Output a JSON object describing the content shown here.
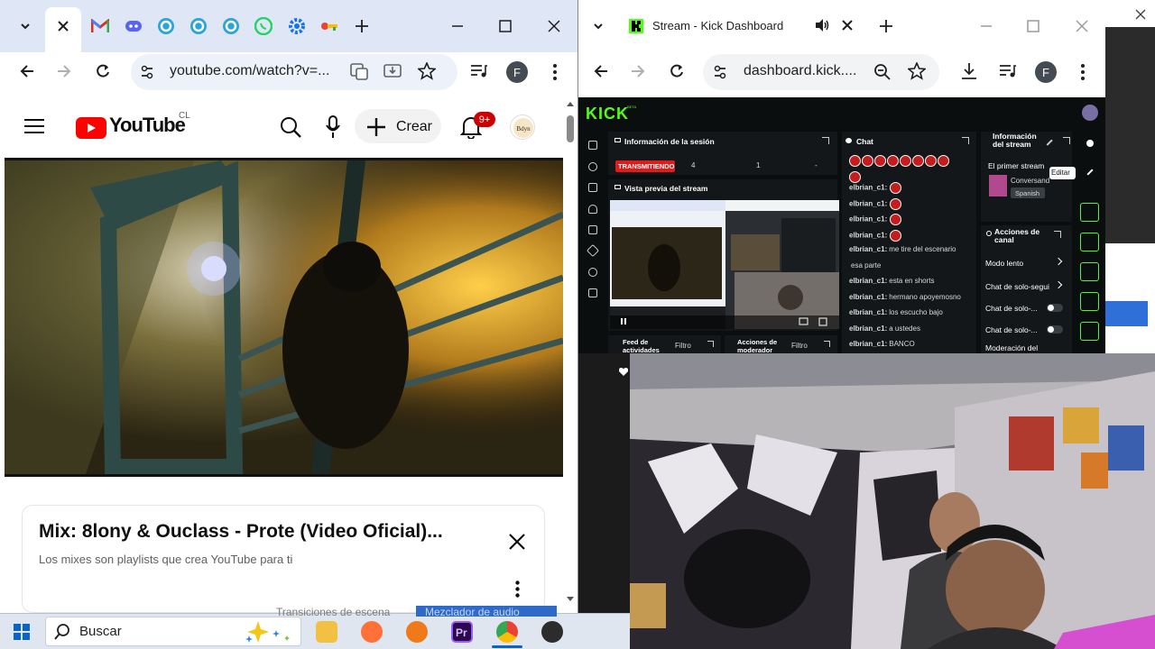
{
  "left_window": {
    "tabs": [
      {
        "label": "YouTube",
        "active": true
      },
      {
        "label": "Gmail"
      },
      {
        "label": "Discord"
      },
      {
        "label": "Tab"
      },
      {
        "label": "Tab"
      },
      {
        "label": "Tab"
      },
      {
        "label": "WhatsApp"
      },
      {
        "label": "Settings"
      },
      {
        "label": "Passwords"
      }
    ],
    "url": "youtube.com/watch?v=...",
    "profile_initial": "F"
  },
  "youtube": {
    "logo_text": "YouTube",
    "region": "CL",
    "create_label": "Crear",
    "notifications_badge": "9+",
    "card_title": "Mix: 8lony & Ouclass - Prote (Video Oficial)...",
    "card_subtitle": "Los mixes son playlists que crea YouTube para ti"
  },
  "right_window": {
    "tab_title": "Stream - Kick Dashboard",
    "url": "dashboard.kick....",
    "profile_initial": "F"
  },
  "kick": {
    "logo": "KICK",
    "logo_badge": "BETA",
    "session_panel": {
      "title": "Información de la sesión",
      "live_label": "TRANSMITIENDO",
      "stat_1": "4",
      "stat_2": "1",
      "stat_3": "-"
    },
    "preview_panel": {
      "title": "Vista previa del stream"
    },
    "chat_panel": {
      "title": "Chat",
      "messages": [
        {
          "user": "elbrian_c1:",
          "text": ""
        },
        {
          "user": "elbrian_c1:",
          "text": ""
        },
        {
          "user": "elbrian_c1:",
          "text": ""
        },
        {
          "user": "elbrian_c1:",
          "text": ""
        },
        {
          "user": "elbrian_c1:",
          "text": "me tire del escenario"
        },
        {
          "user": "",
          "text": "esa parte"
        },
        {
          "user": "elbrian_c1:",
          "text": "esta en shorts"
        },
        {
          "user": "elbrian_c1:",
          "text": "hermano apoyemosno"
        },
        {
          "user": "elbrian_c1:",
          "text": "los escucho bajo"
        },
        {
          "user": "elbrian_c1:",
          "text": "a ustedes"
        },
        {
          "user": "elbrian_c1:",
          "text": "BANCO"
        }
      ]
    },
    "stream_info": {
      "title": "Información del stream",
      "stream_title": "El primer stream",
      "edit_tooltip": "Editar",
      "category": "Conversand",
      "language": "Spanish"
    },
    "channel_actions": {
      "title": "Acciones de canal",
      "items": [
        {
          "label": "Modo lento"
        },
        {
          "label": "Chat de solo-segui"
        },
        {
          "label": "Chat de solo-..."
        },
        {
          "label": "Chat de solo-..."
        },
        {
          "label": "Moderación del"
        }
      ]
    },
    "activity_feed": {
      "title": "Feed de actividades",
      "filter": "Filtro"
    },
    "mod_actions": {
      "title": "Acciones de moderador",
      "filter": "Filtro"
    }
  },
  "taskbar": {
    "search_placeholder": "Buscar",
    "behind_text_1": "Transiciones de escena",
    "behind_text_2": "Mezclador de audio"
  },
  "colors": {
    "kick_green": "#53fc18",
    "youtube_red": "#ff0000",
    "live_red": "#e01b1b"
  }
}
